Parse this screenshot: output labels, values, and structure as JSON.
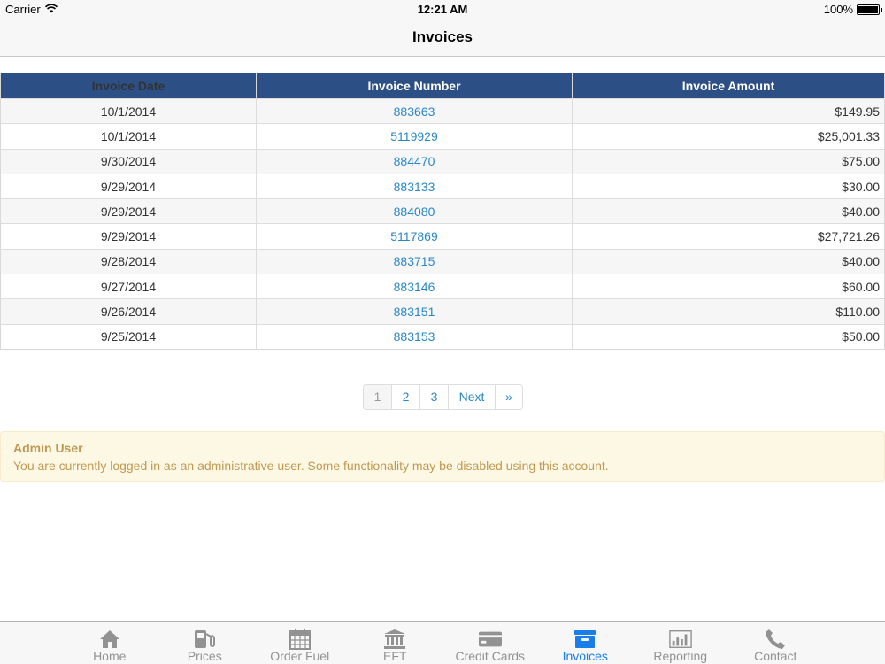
{
  "status_bar": {
    "carrier": "Carrier",
    "time": "12:21 AM",
    "battery": "100%"
  },
  "nav": {
    "title": "Invoices"
  },
  "table": {
    "headers": [
      "Invoice Date",
      "Invoice Number",
      "Invoice Amount"
    ],
    "rows": [
      {
        "date": "10/1/2014",
        "number": "883663",
        "amount": "$149.95"
      },
      {
        "date": "10/1/2014",
        "number": "5119929",
        "amount": "$25,001.33"
      },
      {
        "date": "9/30/2014",
        "number": "884470",
        "amount": "$75.00"
      },
      {
        "date": "9/29/2014",
        "number": "883133",
        "amount": "$30.00"
      },
      {
        "date": "9/29/2014",
        "number": "884080",
        "amount": "$40.00"
      },
      {
        "date": "9/29/2014",
        "number": "5117869",
        "amount": "$27,721.26"
      },
      {
        "date": "9/28/2014",
        "number": "883715",
        "amount": "$40.00"
      },
      {
        "date": "9/27/2014",
        "number": "883146",
        "amount": "$60.00"
      },
      {
        "date": "9/26/2014",
        "number": "883151",
        "amount": "$110.00"
      },
      {
        "date": "9/25/2014",
        "number": "883153",
        "amount": "$50.00"
      }
    ]
  },
  "pagination": {
    "items": [
      "1",
      "2",
      "3",
      "Next",
      "»"
    ],
    "current": "1"
  },
  "alert": {
    "title": "Admin User",
    "message": "You are currently logged in as an administrative user. Some functionality may be disabled using this account."
  },
  "tab_bar": {
    "tabs": [
      {
        "label": "Home",
        "icon": "home-icon"
      },
      {
        "label": "Prices",
        "icon": "fuel-pump-icon"
      },
      {
        "label": "Order Fuel",
        "icon": "calendar-icon"
      },
      {
        "label": "EFT",
        "icon": "bank-icon"
      },
      {
        "label": "Credit Cards",
        "icon": "credit-card-icon"
      },
      {
        "label": "Invoices",
        "icon": "archive-box-icon"
      },
      {
        "label": "Reporting",
        "icon": "bar-chart-icon"
      },
      {
        "label": "Contact",
        "icon": "phone-icon"
      }
    ],
    "active": "Invoices"
  },
  "colors": {
    "header_bg": "#2c4f85",
    "link": "#2a87c6",
    "active_tab": "#1a7ee8",
    "alert_bg": "#fcf8e3",
    "alert_text": "#c09853"
  }
}
